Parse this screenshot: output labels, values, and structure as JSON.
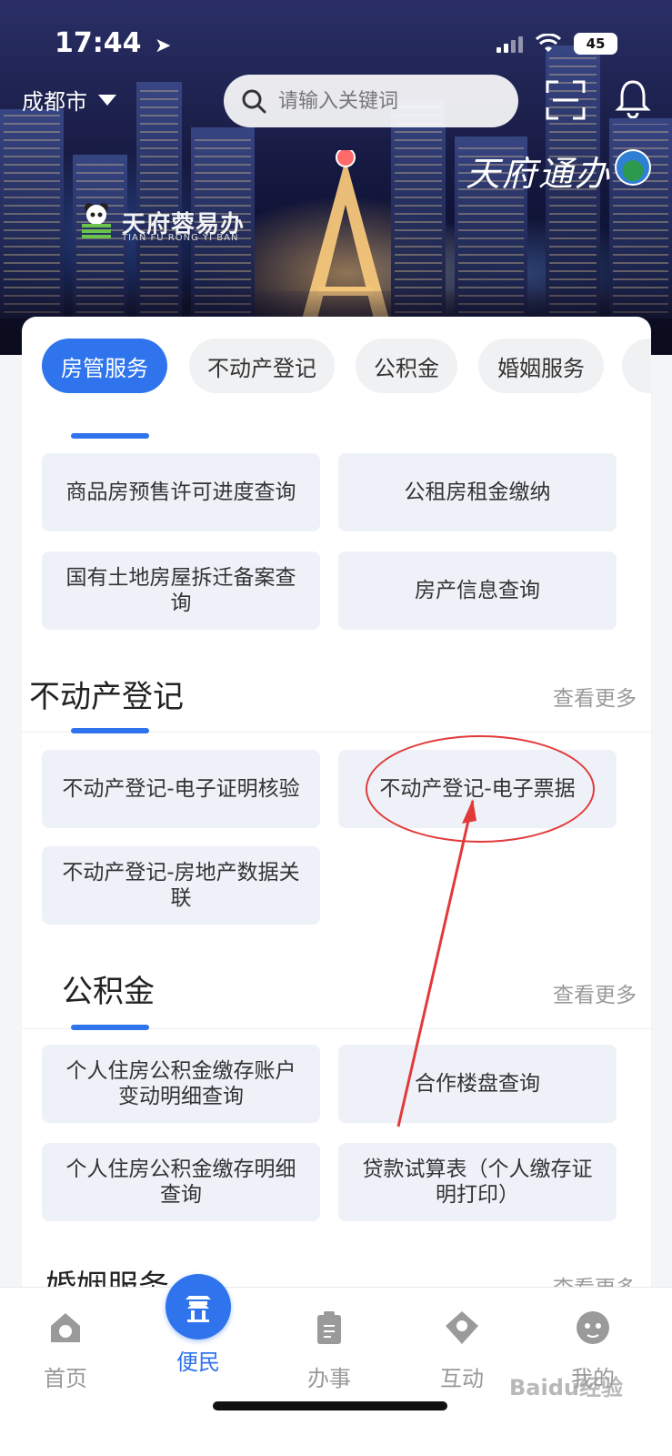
{
  "status": {
    "time": "17:44",
    "battery": "45"
  },
  "header": {
    "city": "成都市",
    "search_placeholder": "请输入关键词",
    "brand_right": "天府通办",
    "brand_left_cn": "天府蓉易办",
    "brand_left_en": "TIAN FU RONG YI BAN"
  },
  "chips": [
    "房管服务",
    "不动产登记",
    "公积金",
    "婚姻服务"
  ],
  "housing": {
    "items": [
      "商品房预售许可进度查询",
      "公租房租金缴纳",
      "国有土地房屋拆迁备案查询",
      "房产信息查询"
    ]
  },
  "realestate": {
    "title": "不动产登记",
    "more": "查看更多",
    "items": [
      "不动产登记-电子证明核验",
      "不动产登记-电子票据",
      "不动产登记-房地产数据关联"
    ]
  },
  "fund": {
    "title": "公积金",
    "more": "查看更多",
    "items": [
      "个人住房公积金缴存账户变动明细查询",
      "合作楼盘查询",
      "个人住房公积金缴存明细查询",
      "贷款试算表（个人缴存证明打印）"
    ]
  },
  "marriage": {
    "title": "婚姻服务",
    "more": "查看更多"
  },
  "tabbar": [
    "首页",
    "便民",
    "办事",
    "互动",
    "我的"
  ],
  "watermark": "Baidu经验",
  "colors": {
    "accent": "#2f74ec",
    "annotation": "#e23a3a"
  }
}
